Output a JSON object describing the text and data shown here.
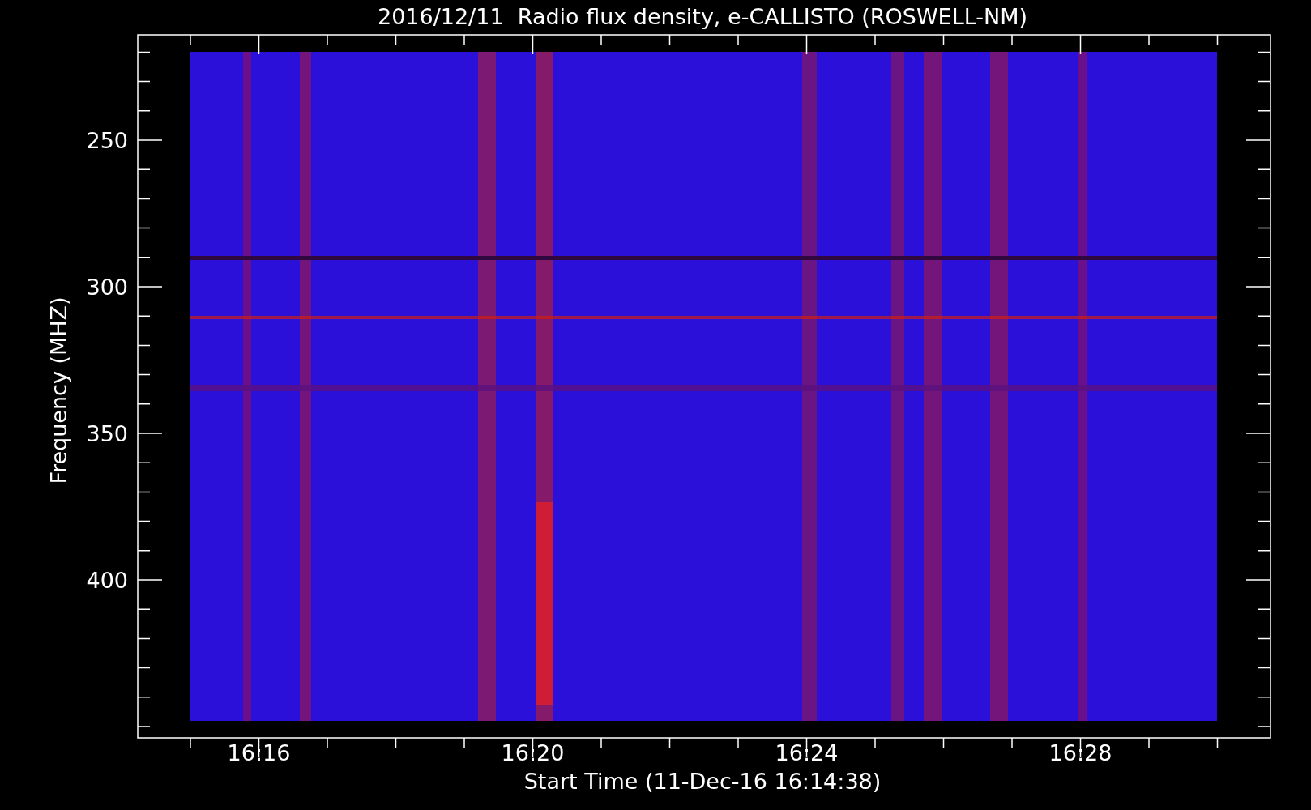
{
  "title": "2016/12/11  Radio flux density, e-CALLISTO (ROSWELL-NM)",
  "y_axis": {
    "label": "Frequency (MHZ)",
    "tick_labels": [
      "250",
      "300",
      "350",
      "400"
    ]
  },
  "x_axis": {
    "label": "Start Time (11-Dec-16 16:14:38)",
    "tick_labels": [
      "16:16",
      "16:20",
      "16:24",
      "16:28"
    ]
  }
}
